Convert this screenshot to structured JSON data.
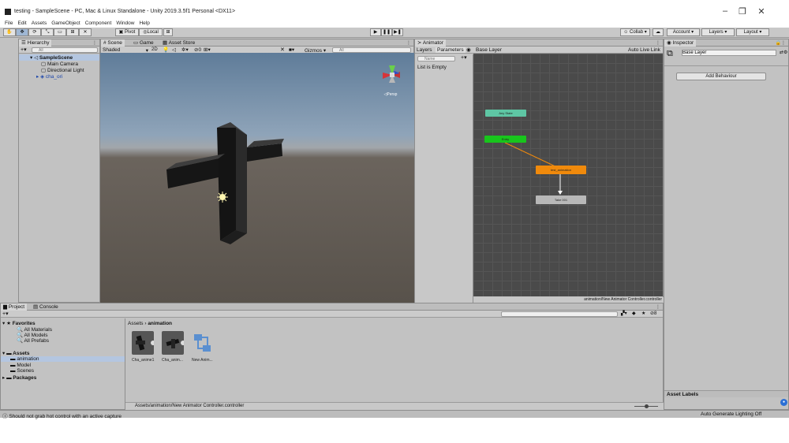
{
  "window": {
    "title": "testing - SampleScene - PC, Mac & Linux Standalone - Unity 2019.3.5f1 Personal <DX11>",
    "minimize": "–",
    "maximize": "❐",
    "close": "✕"
  },
  "menu": [
    "File",
    "Edit",
    "Assets",
    "GameObject",
    "Component",
    "Window",
    "Help"
  ],
  "toolbar": {
    "pivot": "Pivot",
    "local": "Local",
    "collab": "Collab",
    "account": "Account",
    "layers": "Layers",
    "layout": "Layout"
  },
  "hierarchy": {
    "tab": "Hierarchy",
    "search_placeholder": "All",
    "scene": "SampleScene",
    "items": [
      "Main Camera",
      "Directional Light",
      "cha_ori"
    ]
  },
  "scene": {
    "tabs": [
      "Scene",
      "Game",
      "Asset Store"
    ],
    "shading": "Shaded",
    "mode2d": "2D",
    "gizmos": "Gizmos",
    "search_placeholder": "All",
    "persp": "◁Persp"
  },
  "animator": {
    "tab": "Animator",
    "subtabs": [
      "Layers",
      "Parameters"
    ],
    "breadcrumb": "Base Layer",
    "auto_live_link": "Auto Live Link",
    "name_placeholder": "Name",
    "list_empty": "List is Empty",
    "nodes": {
      "any_state": "Any State",
      "entry": "Entry",
      "default": "test_animation",
      "exit": "Take 001"
    },
    "footer_path": "animation/New Animator Controller.controller"
  },
  "inspector": {
    "tab": "Inspector",
    "layer_name": "Base Layer",
    "add_behaviour": "Add Behaviour",
    "asset_labels": "Asset Labels"
  },
  "project": {
    "tabs": [
      "Project",
      "Console"
    ],
    "favorites": "Favorites",
    "favorite_items": [
      "All Materials",
      "All Models",
      "All Prefabs"
    ],
    "assets": "Assets",
    "asset_folders": [
      "animation",
      "Model",
      "Scenes"
    ],
    "packages": "Packages",
    "breadcrumb_root": "Assets",
    "breadcrumb_sep": "›",
    "breadcrumb_current": "animation",
    "files": [
      "Cha_anime1",
      "Cha_anim...",
      "New Anim..."
    ],
    "selected_path": "Assets/animation/New Animator Controller.controller",
    "count": "8"
  },
  "status": {
    "message": "Should not grab hot control with an active capture",
    "lighting": "Auto Generate Lighting Off"
  },
  "colors": {
    "entry_node": "#18c51c",
    "any_state_node": "#5ec6a4",
    "default_node": "#f08a0c",
    "exit_node": "#b8b8b8"
  }
}
